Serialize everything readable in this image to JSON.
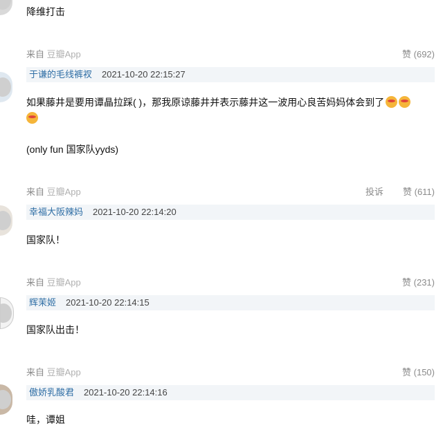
{
  "comments": [
    {
      "text_partial": "降维打击"
    },
    {
      "source_prefix": "来自",
      "source_app": "豆瓣App",
      "likes": "赞 (692)",
      "username": "于谦的毛线裤衩",
      "time": "2021-10-20 22:15:27",
      "line1": "如果藤井是要用谭晶拉踩( )，那我原谅藤井并表示藤井这一波用心良苦妈妈体会到了",
      "line2": "",
      "line3": "(only fun 国家队yyds)",
      "emoji_name": "heart-eyes-emoji"
    },
    {
      "source_prefix": "来自",
      "source_app": "豆瓣App",
      "report": "投诉",
      "likes": "赞 (611)",
      "username": "幸福大阪辣妈",
      "time": "2021-10-20 22:14:20",
      "text": "国家队！"
    },
    {
      "source_prefix": "来自",
      "source_app": "豆瓣App",
      "likes": "赞 (231)",
      "username": "辉茉姬",
      "time": "2021-10-20 22:14:15",
      "text": "国家队出击！"
    },
    {
      "source_prefix": "来自",
      "source_app": "豆瓣App",
      "likes": "赞 (150)",
      "username": "傲娇乳酸君",
      "time": "2021-10-20 22:14:16",
      "text": "哇，谭姐"
    }
  ]
}
